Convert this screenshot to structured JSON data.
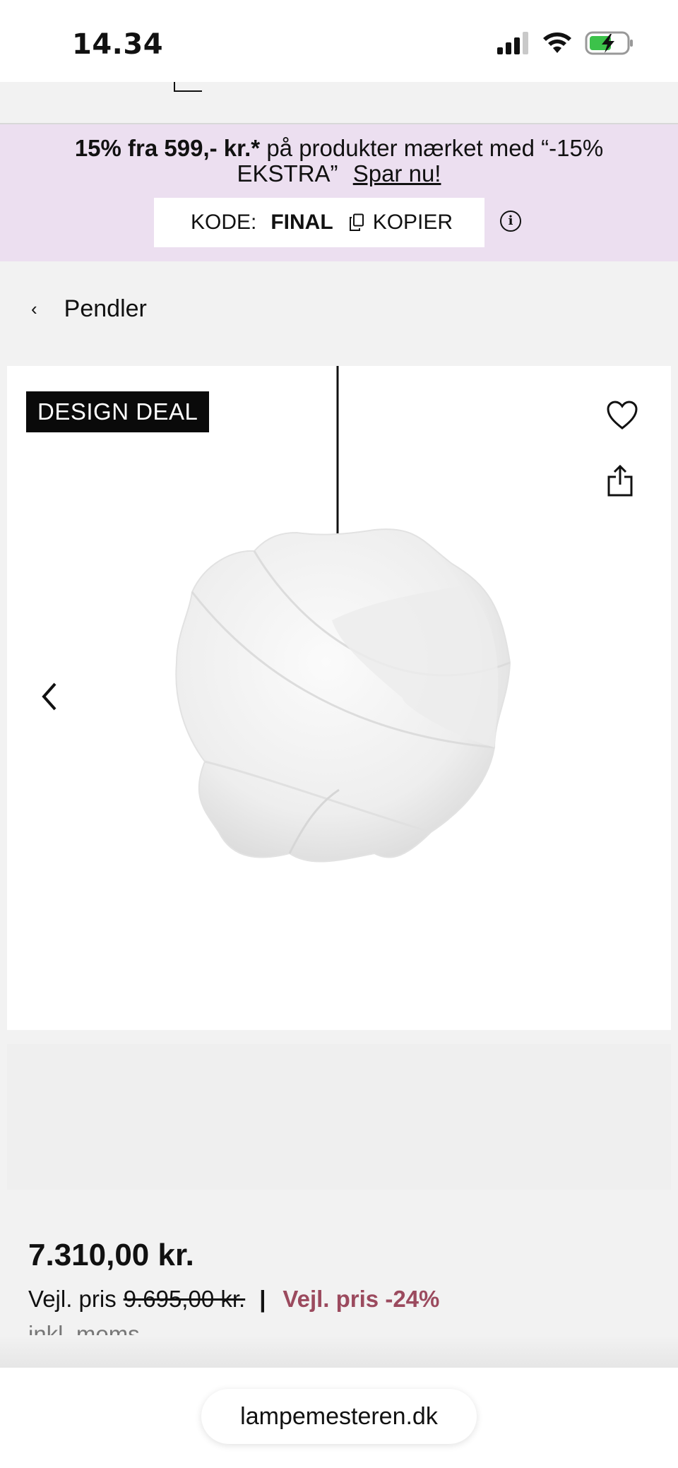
{
  "status_bar": {
    "time": "14.34",
    "icons": [
      "signal-icon",
      "wifi-icon",
      "battery-charging-icon"
    ]
  },
  "promo": {
    "bold_text": "15% fra 599,- kr.*",
    "text": " på produkter mærket med “-15% EKSTRA” ",
    "link": "Spar nu!",
    "code_label": "KODE:",
    "code_value": "FINAL",
    "copy_label": "KOPIER",
    "background_color": "#ecdff0"
  },
  "breadcrumb": {
    "label": "Pendler"
  },
  "product": {
    "badge": "DESIGN DEAL",
    "price": "7.310,00 kr.",
    "rrp_label": "Vejl. pris",
    "rrp_value": "9.695,00 kr.",
    "separator": "|",
    "discount": "Vejl. pris -24%",
    "vat_note": "inkl. moms",
    "discount_color": "#9b4a5e"
  },
  "browser": {
    "url": "lampemesteren.dk"
  }
}
